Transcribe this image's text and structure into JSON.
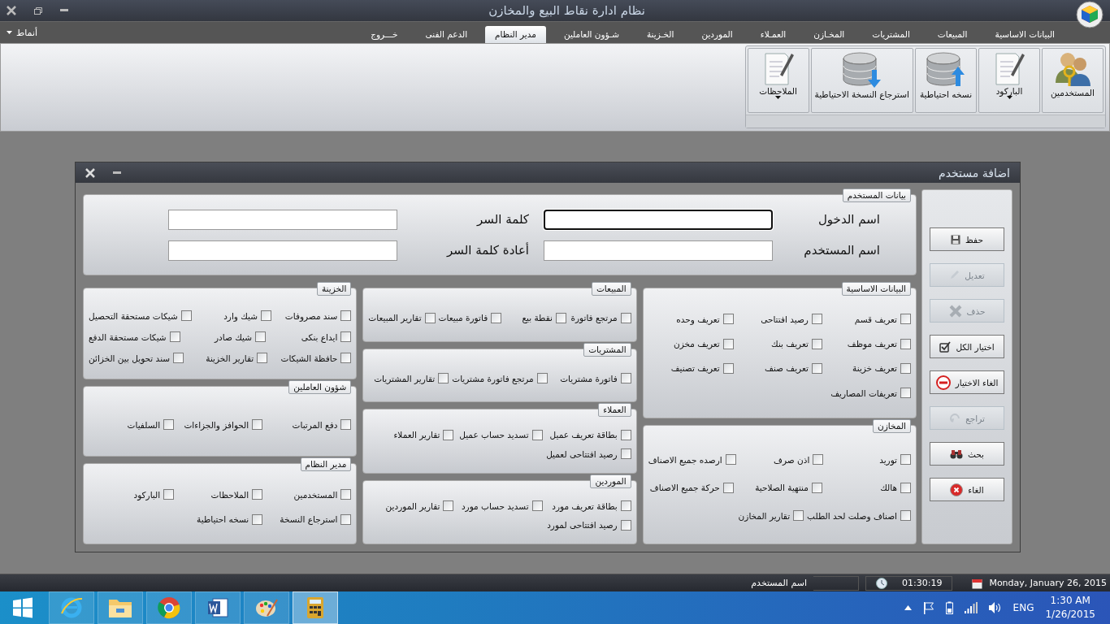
{
  "window": {
    "title": "نظام ادارة نقاط البيع والمخازن"
  },
  "styles_menu": {
    "label": "أنماط"
  },
  "menu_tabs": [
    {
      "label": "البيانات الاساسية",
      "selected": false
    },
    {
      "label": "المبيعات",
      "selected": false
    },
    {
      "label": "المشتريات",
      "selected": false
    },
    {
      "label": "المخـازن",
      "selected": false
    },
    {
      "label": "العمـلاء",
      "selected": false
    },
    {
      "label": "الموردين",
      "selected": false
    },
    {
      "label": "الخـزينة",
      "selected": false
    },
    {
      "label": "شـؤون العاملين",
      "selected": false
    },
    {
      "label": "مدير النظام",
      "selected": true
    },
    {
      "label": "الدعم الفنى",
      "selected": false
    },
    {
      "label": "خـــروج",
      "selected": false
    }
  ],
  "ribbon": {
    "buttons": [
      {
        "label": "المستخدمين",
        "kind": "users",
        "dropdown": false
      },
      {
        "label": "الباركود",
        "kind": "document",
        "dropdown": true
      },
      {
        "label": "نسخه احتياطية",
        "kind": "backup",
        "dropdown": false
      },
      {
        "label": "استرجاع النسخة الاحتياطية",
        "kind": "restore",
        "dropdown": false
      },
      {
        "label": "الملاحظات",
        "kind": "document",
        "dropdown": true
      }
    ]
  },
  "dialog": {
    "title": "اضافة مستخدم",
    "user_data": {
      "title": "بيانات المستخدم",
      "fields": [
        {
          "label": "اسم الدخول",
          "focused": true
        },
        {
          "label": "كلمة السر",
          "focused": false
        },
        {
          "label": "اسم المستخدم",
          "focused": false
        },
        {
          "label": "أعادة كلمة السر",
          "focused": false
        }
      ]
    },
    "columns": [
      {
        "groups": [
          {
            "title": "البيانات الاساسية",
            "rows": [
              [
                {
                  "label": "تعريف قسم",
                  "checked": false
                },
                {
                  "label": "رصيد افتتاحى",
                  "checked": false
                },
                {
                  "label": "تعريف وحده",
                  "checked": false
                }
              ],
              [
                {
                  "label": "تعريف موظف",
                  "checked": false
                },
                {
                  "label": "تعريف بنك",
                  "checked": false
                },
                {
                  "label": "تعريف مخزن",
                  "checked": false
                }
              ],
              [
                {
                  "label": "تعريف خزينة",
                  "checked": false
                },
                {
                  "label": "تعريف صنف",
                  "checked": false
                },
                {
                  "label": "تعريف تصنيف",
                  "checked": false
                }
              ],
              [
                {
                  "label": "تعريفات المصاريف",
                  "checked": false
                }
              ]
            ]
          },
          {
            "title": "المخازن",
            "rows": [
              [
                {
                  "label": "توريد",
                  "checked": false
                },
                {
                  "label": "اذن صرف",
                  "checked": false
                },
                {
                  "label": "ارصده جميع الاصناف",
                  "checked": false
                }
              ],
              [
                {
                  "label": "هالك",
                  "checked": false
                },
                {
                  "label": "منتهية الصلاحية",
                  "checked": false
                },
                {
                  "label": "حركة جميع الاصناف",
                  "checked": false
                }
              ],
              [
                {
                  "label": "اصناف وصلت لحد الطلب",
                  "checked": false
                },
                {
                  "label": "تقارير المخازن",
                  "checked": false
                }
              ]
            ]
          }
        ]
      },
      {
        "groups": [
          {
            "title": "المبيعات",
            "rows": [
              [
                {
                  "label": "مرتجع فاتورة",
                  "checked": false
                },
                {
                  "label": "نقطة بيع",
                  "checked": false
                },
                {
                  "label": "فاتورة مبيعات",
                  "checked": false
                },
                {
                  "label": "تقارير المبيعات",
                  "checked": false
                }
              ]
            ]
          },
          {
            "title": "المشتريات",
            "rows": [
              [
                {
                  "label": "فاتورة مشتريات",
                  "checked": false
                },
                {
                  "label": "مرتجع فاتورة مشتريات",
                  "checked": false
                },
                {
                  "label": "تقارير المشتريات",
                  "checked": false
                }
              ]
            ]
          },
          {
            "title": "العملاء",
            "rows": [
              [
                {
                  "label": "بطاقة تعريف عميل",
                  "checked": false
                },
                {
                  "label": "تسديد حساب عميل",
                  "checked": false
                },
                {
                  "label": "تقارير العملاء",
                  "checked": false
                }
              ],
              [
                {
                  "label": "رصيد افتتاحى لعميل",
                  "checked": false
                }
              ]
            ]
          },
          {
            "title": "الموردين",
            "rows": [
              [
                {
                  "label": "بطاقة تعريف مورد",
                  "checked": false
                },
                {
                  "label": "تسديد حساب مورد",
                  "checked": false
                },
                {
                  "label": "تقارير الموردين",
                  "checked": false
                }
              ],
              [
                {
                  "label": "رصيد افتتاحى لمورد",
                  "checked": false
                }
              ]
            ]
          }
        ]
      },
      {
        "groups": [
          {
            "title": "الخزينة",
            "rows": [
              [
                {
                  "label": "سند مصروفات",
                  "checked": false
                },
                {
                  "label": "شيك وارد",
                  "checked": false
                },
                {
                  "label": "شيكات مستحقة التحصيل",
                  "checked": false
                }
              ],
              [
                {
                  "label": "ايداع بنكى",
                  "checked": false
                },
                {
                  "label": "شيك صادر",
                  "checked": false
                },
                {
                  "label": "شيكات مستحقة الدفع",
                  "checked": false
                }
              ],
              [
                {
                  "label": "حافظة الشيكات",
                  "checked": false
                },
                {
                  "label": "تقارير الخزينة",
                  "checked": false
                },
                {
                  "label": "سند تحويل بين الخزائن",
                  "checked": false
                }
              ]
            ]
          },
          {
            "title": "شؤون العاملين",
            "rows": [
              [
                {
                  "label": "دفع المرتبات",
                  "checked": false
                },
                {
                  "label": "الحوافز والجزاءات",
                  "checked": false
                },
                {
                  "label": "السلفيات",
                  "checked": false
                }
              ]
            ]
          },
          {
            "title": "مدير النظام",
            "rows": [
              [
                {
                  "label": "المستخدمين",
                  "checked": false
                },
                {
                  "label": "الملاحظات",
                  "checked": false
                },
                {
                  "label": "الباركود",
                  "checked": false
                }
              ],
              [
                {
                  "label": "استرجاع النسخة",
                  "checked": false
                },
                {
                  "label": "نسخه احتياطية",
                  "checked": false
                }
              ]
            ]
          }
        ]
      }
    ],
    "actions": [
      {
        "label": "حفظ",
        "kind": "save",
        "disabled": false
      },
      {
        "label": "تعديل",
        "kind": "edit",
        "disabled": true
      },
      {
        "label": "حذف",
        "kind": "delete",
        "disabled": true
      },
      {
        "label": "اختيار الكل",
        "kind": "select-all",
        "disabled": false
      },
      {
        "label": "الغاء الاختيار",
        "kind": "deselect",
        "disabled": false
      },
      {
        "label": "تراجع",
        "kind": "undo",
        "disabled": true
      },
      {
        "label": "بحث",
        "kind": "search",
        "disabled": false
      },
      {
        "label": "الغاء",
        "kind": "cancel",
        "disabled": false
      }
    ]
  },
  "status_bar": {
    "user_label": "اسم المستخدم",
    "time": "01:30:19",
    "date": "Monday, January 26, 2015"
  },
  "taskbar": {
    "apps": [
      {
        "kind": "ie",
        "selected": false
      },
      {
        "kind": "explorer",
        "selected": false
      },
      {
        "kind": "chrome",
        "selected": false
      },
      {
        "kind": "word",
        "selected": false
      },
      {
        "kind": "paint",
        "selected": false
      },
      {
        "kind": "calculator",
        "selected": true
      }
    ],
    "language": "ENG",
    "time": "1:30 AM",
    "date": "1/26/2015"
  }
}
